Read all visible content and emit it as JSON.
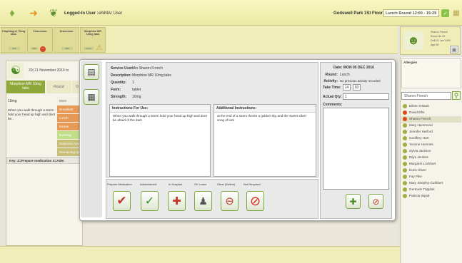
{
  "header": {
    "logged_in_label": "Logged-In User :",
    "user": "ehiMAr User",
    "location": "Godswell Park 1St Floor",
    "round": "Lunch Round 12:00 - 15:29"
  },
  "tabs": [
    {
      "label": "Clopidogrel 75mg tabs",
      "chip": "###"
    },
    {
      "label": "Zenocmon",
      "chip": "###"
    },
    {
      "label": "Zenocmon",
      "chip": "###"
    },
    {
      "label": "Morphine MR 10mg tabs",
      "chip": "Lunch"
    }
  ],
  "patient_card": {
    "name": "Sharon French",
    "room": "Room No 23",
    "dob": "DoB 01 Jan 1990",
    "age": "Age 85"
  },
  "left_panel": {
    "date": "20| 21 November 2016 to",
    "med_tab": "Morphine MR 10mg tabs",
    "round_tab": "Round",
    "other_tab": "D",
    "dose": "10mg",
    "instructions": "When you walk through a storm hold your head up high and dont be...",
    "rounds": [
      "Morn",
      "Breakfast",
      "Lunch",
      "Dinner",
      "Evening",
      "Dispense Area",
      "Remaining Qty"
    ],
    "key": "Key: Z=Prepare medication X=Adm"
  },
  "dialog": {
    "service_user_label": "Service User:",
    "service_user": "Mrs Sharon French",
    "description_label": "Description:",
    "description": "Morphine MR 10mg tabs",
    "quantity_label": "Quantity:",
    "quantity": "1",
    "form_label": "Form:",
    "form": "tablet",
    "strength_label": "Strength:",
    "strength": "10mg",
    "instructions_title": "Instructions For Use:",
    "instructions": "When you walk through a storm hold your head up high and dont be afraid of the dark",
    "additional_title": "Additional Instructions:",
    "additional": "at the end of a storm theres a golden sky and the sweet silver song of lark",
    "date_label": "Date: MON 05 DEC 2016",
    "round_label": "Round:",
    "round": "Lunch",
    "activity_label": "Activity:",
    "activity": "No previous activity recorded",
    "take_time_label": "Take Time:",
    "take_hour": "14",
    "take_min": "03",
    "actual_qty_label": "Actual Qty:",
    "actual_qty": "1",
    "comments_label": "Comments:",
    "actions": [
      "Prepare Medication",
      "Administered",
      "In Hospital",
      "On Leave",
      "Other (Define)",
      "Not Required"
    ]
  },
  "allergies_label": "Allergies",
  "search": {
    "value": "Sharon French"
  },
  "patients": [
    {
      "name": "Eileen Ostwin",
      "status": "ok"
    },
    {
      "name": "David Ellis",
      "status": "alert"
    },
    {
      "name": "Sharon French",
      "status": "alert"
    },
    {
      "name": "Mary Hammond",
      "status": "ok"
    },
    {
      "name": "Jennifer Harford",
      "status": "ok"
    },
    {
      "name": "Geoffrey Hart",
      "status": "ok"
    },
    {
      "name": "Yvonne Humries",
      "status": "ok"
    },
    {
      "name": "Sylvia Jackson",
      "status": "ok"
    },
    {
      "name": "Dilys Jenkins",
      "status": "ok"
    },
    {
      "name": "Margaret Lockhart",
      "status": "ok"
    },
    {
      "name": "Doris Oliver",
      "status": "ok"
    },
    {
      "name": "Fay Pike",
      "status": "ok"
    },
    {
      "name": "Mary Shepley-Cuthbert",
      "status": "ok"
    },
    {
      "name": "Gertrude Tripplok",
      "status": "ok"
    },
    {
      "name": "Patricia Wyatt",
      "status": "ok"
    }
  ]
}
